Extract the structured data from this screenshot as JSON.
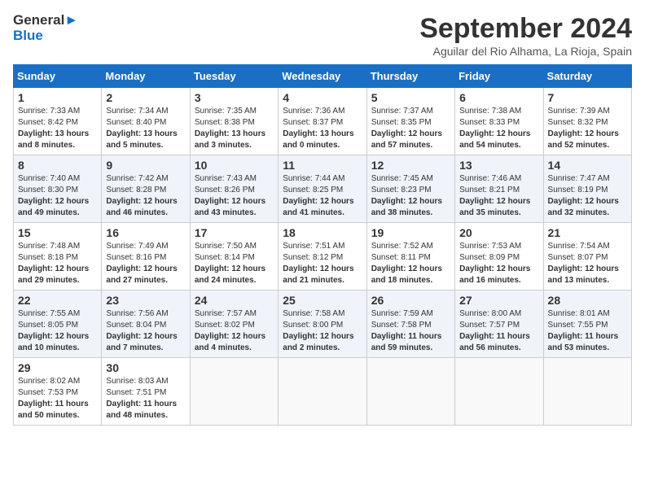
{
  "header": {
    "logo_line1": "General",
    "logo_line2": "Blue",
    "month_title": "September 2024",
    "location": "Aguilar del Rio Alhama, La Rioja, Spain"
  },
  "weekdays": [
    "Sunday",
    "Monday",
    "Tuesday",
    "Wednesday",
    "Thursday",
    "Friday",
    "Saturday"
  ],
  "weeks": [
    [
      {
        "day": "1",
        "info": "Sunrise: 7:33 AM\nSunset: 8:42 PM\nDaylight: 13 hours and 8 minutes."
      },
      {
        "day": "2",
        "info": "Sunrise: 7:34 AM\nSunset: 8:40 PM\nDaylight: 13 hours and 5 minutes."
      },
      {
        "day": "3",
        "info": "Sunrise: 7:35 AM\nSunset: 8:38 PM\nDaylight: 13 hours and 3 minutes."
      },
      {
        "day": "4",
        "info": "Sunrise: 7:36 AM\nSunset: 8:37 PM\nDaylight: 13 hours and 0 minutes."
      },
      {
        "day": "5",
        "info": "Sunrise: 7:37 AM\nSunset: 8:35 PM\nDaylight: 12 hours and 57 minutes."
      },
      {
        "day": "6",
        "info": "Sunrise: 7:38 AM\nSunset: 8:33 PM\nDaylight: 12 hours and 54 minutes."
      },
      {
        "day": "7",
        "info": "Sunrise: 7:39 AM\nSunset: 8:32 PM\nDaylight: 12 hours and 52 minutes."
      }
    ],
    [
      {
        "day": "8",
        "info": "Sunrise: 7:40 AM\nSunset: 8:30 PM\nDaylight: 12 hours and 49 minutes."
      },
      {
        "day": "9",
        "info": "Sunrise: 7:42 AM\nSunset: 8:28 PM\nDaylight: 12 hours and 46 minutes."
      },
      {
        "day": "10",
        "info": "Sunrise: 7:43 AM\nSunset: 8:26 PM\nDaylight: 12 hours and 43 minutes."
      },
      {
        "day": "11",
        "info": "Sunrise: 7:44 AM\nSunset: 8:25 PM\nDaylight: 12 hours and 41 minutes."
      },
      {
        "day": "12",
        "info": "Sunrise: 7:45 AM\nSunset: 8:23 PM\nDaylight: 12 hours and 38 minutes."
      },
      {
        "day": "13",
        "info": "Sunrise: 7:46 AM\nSunset: 8:21 PM\nDaylight: 12 hours and 35 minutes."
      },
      {
        "day": "14",
        "info": "Sunrise: 7:47 AM\nSunset: 8:19 PM\nDaylight: 12 hours and 32 minutes."
      }
    ],
    [
      {
        "day": "15",
        "info": "Sunrise: 7:48 AM\nSunset: 8:18 PM\nDaylight: 12 hours and 29 minutes."
      },
      {
        "day": "16",
        "info": "Sunrise: 7:49 AM\nSunset: 8:16 PM\nDaylight: 12 hours and 27 minutes."
      },
      {
        "day": "17",
        "info": "Sunrise: 7:50 AM\nSunset: 8:14 PM\nDaylight: 12 hours and 24 minutes."
      },
      {
        "day": "18",
        "info": "Sunrise: 7:51 AM\nSunset: 8:12 PM\nDaylight: 12 hours and 21 minutes."
      },
      {
        "day": "19",
        "info": "Sunrise: 7:52 AM\nSunset: 8:11 PM\nDaylight: 12 hours and 18 minutes."
      },
      {
        "day": "20",
        "info": "Sunrise: 7:53 AM\nSunset: 8:09 PM\nDaylight: 12 hours and 16 minutes."
      },
      {
        "day": "21",
        "info": "Sunrise: 7:54 AM\nSunset: 8:07 PM\nDaylight: 12 hours and 13 minutes."
      }
    ],
    [
      {
        "day": "22",
        "info": "Sunrise: 7:55 AM\nSunset: 8:05 PM\nDaylight: 12 hours and 10 minutes."
      },
      {
        "day": "23",
        "info": "Sunrise: 7:56 AM\nSunset: 8:04 PM\nDaylight: 12 hours and 7 minutes."
      },
      {
        "day": "24",
        "info": "Sunrise: 7:57 AM\nSunset: 8:02 PM\nDaylight: 12 hours and 4 minutes."
      },
      {
        "day": "25",
        "info": "Sunrise: 7:58 AM\nSunset: 8:00 PM\nDaylight: 12 hours and 2 minutes."
      },
      {
        "day": "26",
        "info": "Sunrise: 7:59 AM\nSunset: 7:58 PM\nDaylight: 11 hours and 59 minutes."
      },
      {
        "day": "27",
        "info": "Sunrise: 8:00 AM\nSunset: 7:57 PM\nDaylight: 11 hours and 56 minutes."
      },
      {
        "day": "28",
        "info": "Sunrise: 8:01 AM\nSunset: 7:55 PM\nDaylight: 11 hours and 53 minutes."
      }
    ],
    [
      {
        "day": "29",
        "info": "Sunrise: 8:02 AM\nSunset: 7:53 PM\nDaylight: 11 hours and 50 minutes."
      },
      {
        "day": "30",
        "info": "Sunrise: 8:03 AM\nSunset: 7:51 PM\nDaylight: 11 hours and 48 minutes."
      },
      {
        "day": "",
        "info": ""
      },
      {
        "day": "",
        "info": ""
      },
      {
        "day": "",
        "info": ""
      },
      {
        "day": "",
        "info": ""
      },
      {
        "day": "",
        "info": ""
      }
    ]
  ]
}
